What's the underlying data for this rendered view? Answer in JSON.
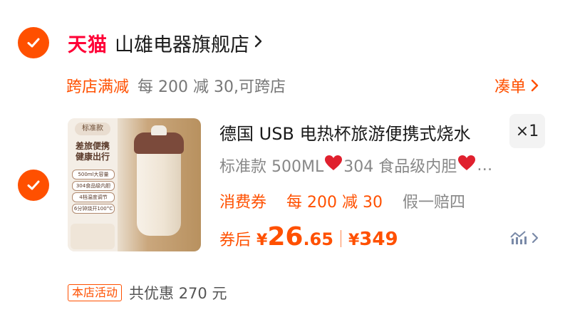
{
  "store": {
    "checked": true,
    "brand": "天猫",
    "name": "山雄电器旗舰店"
  },
  "promo": {
    "tag": "跨店满减",
    "desc": "每 200 减 30,可跨店",
    "combine_label": "凑单"
  },
  "item": {
    "checked": true,
    "thumb": {
      "badge": "标准款",
      "headline_1": "差旅便携",
      "headline_2": "健康出行",
      "features": [
        "500ml大容量",
        "304食品级内胆",
        "4档温度调节",
        "6分钟烧开100°C"
      ]
    },
    "title": "德国 USB 电热杯旅游便携式烧水",
    "quantity": "×1",
    "spec_prefix": "标准款 500ML",
    "spec_mid": "304 食品级内胆",
    "spec_suffix": "…",
    "chips": {
      "coupon": "消费券",
      "deal": "每 200 减 30",
      "guarantee": "假一赔四"
    },
    "price": {
      "after_label": "券后",
      "currency": "¥",
      "integer": "26",
      "decimal": ".65",
      "original_currency": "¥",
      "original": "349"
    }
  },
  "activity": {
    "tag": "本店活动",
    "desc": "共优惠 270 元"
  },
  "colors": {
    "accent": "#ff5000",
    "tmall_red": "#ff0036",
    "muted": "#888888"
  }
}
